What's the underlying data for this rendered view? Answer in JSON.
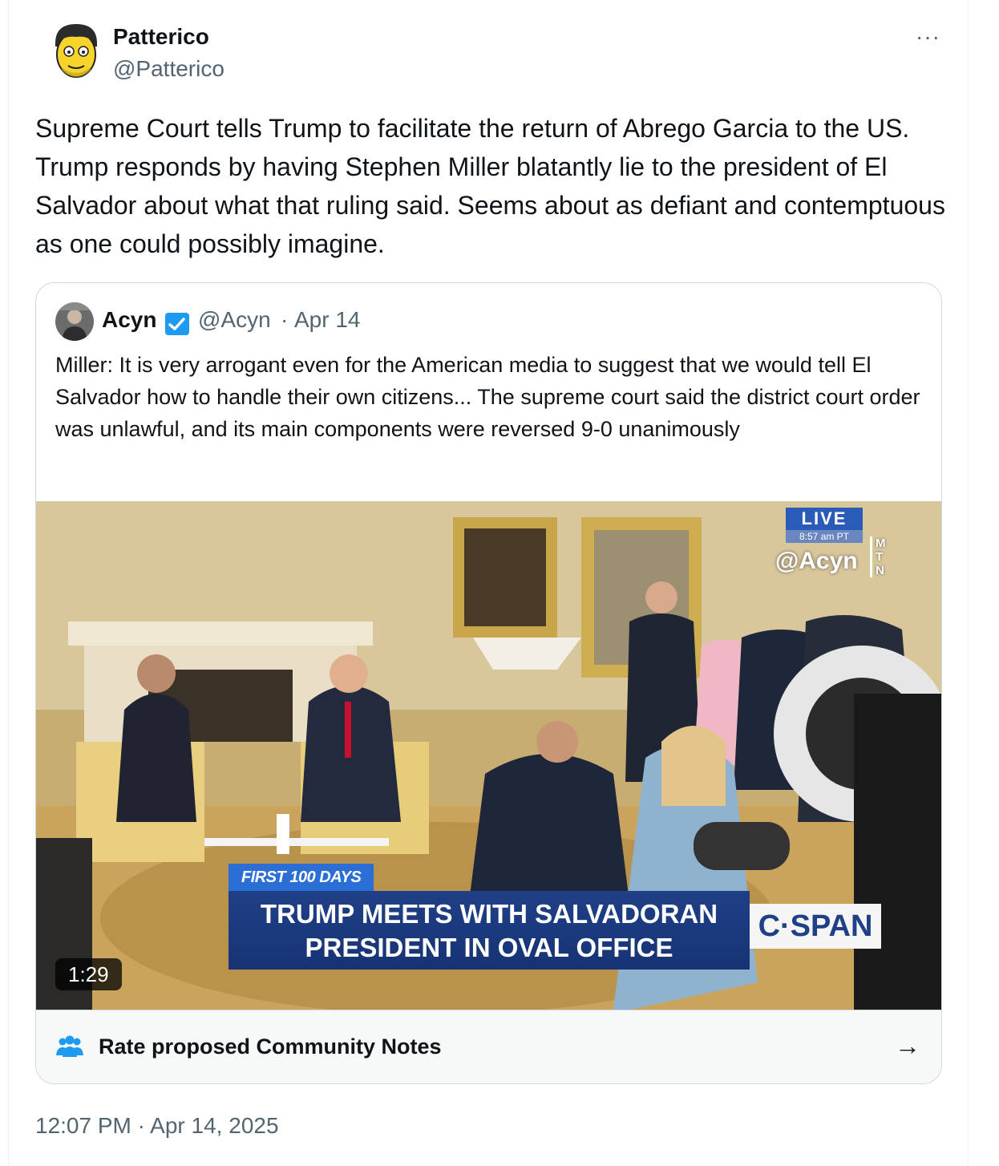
{
  "author": {
    "name": "Patterico",
    "handle": "@Patterico",
    "avatar_icon": "cartoon-face-avatar"
  },
  "more_label": "···",
  "tweet_text": "Supreme Court tells Trump to facilitate the return of Abrego Garcia to the US. Trump responds by having Stephen Miller blatantly lie to the president of El Salvador about what that ruling said. Seems about as defiant and contemptuous as one could possibly imagine.",
  "quote": {
    "name": "Acyn",
    "handle": "@Acyn",
    "separator": "·",
    "date": "Apr 14",
    "verified_icon": "verified-badge-icon",
    "text": "Miller: It is very arrogant even for the American media to suggest that we would tell El Salvador how to handle their own citizens... The supreme court said the district court order was unlawful, and its main components were reversed 9-0 unanimously",
    "media": {
      "chyron_tag": "FIRST 100 DAYS",
      "chyron_line1": "TRUMP MEETS WITH SALVADORAN",
      "chyron_line2": "PRESIDENT IN OVAL OFFICE",
      "network": "C·SPAN",
      "live_label": "LIVE",
      "live_time": "8:57 am PT",
      "watermark": "@Acyn",
      "mtn_letters": "M T N",
      "duration": "1:29"
    },
    "community_notes_label": "Rate proposed Community Notes",
    "community_notes_icon": "people-icon",
    "arrow": "→"
  },
  "timestamp": "12:07 PM · Apr 14, 2025",
  "colors": {
    "text": "#0f1419",
    "secondary": "#536471",
    "border": "#cfd9de",
    "verified": "#1d9bf0",
    "chyron_blue": "#1f3f86"
  }
}
